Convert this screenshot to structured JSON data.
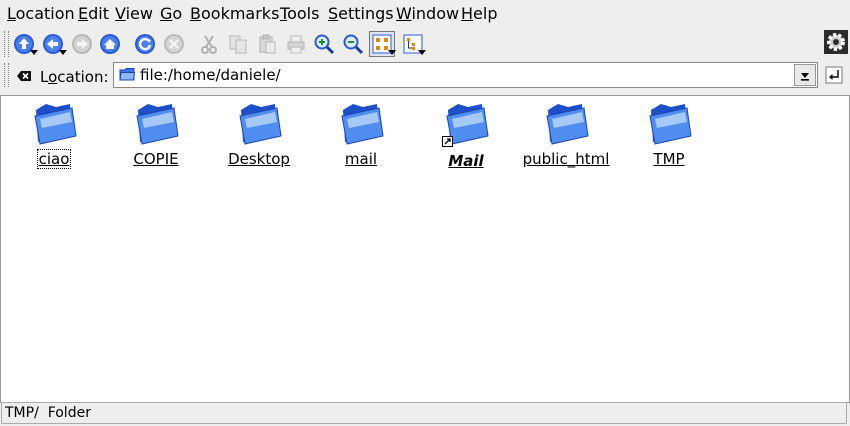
{
  "menu": {
    "items": [
      {
        "accel": "L",
        "rest": "ocation"
      },
      {
        "accel": "E",
        "rest": "dit"
      },
      {
        "accel": "V",
        "rest": "iew"
      },
      {
        "accel": "G",
        "rest": "o"
      },
      {
        "accel": "B",
        "rest": "ookmarks"
      },
      {
        "accel": "T",
        "rest": "ools"
      },
      {
        "accel": "S",
        "rest": "ettings"
      },
      {
        "accel": "W",
        "rest": "indow"
      },
      {
        "accel": "H",
        "rest": "elp"
      }
    ]
  },
  "location": {
    "label": "Location:",
    "label_accel_index": 1,
    "label_pre": "L",
    "label_accel": "o",
    "label_post": "cation:",
    "value": "file:/home/daniele/"
  },
  "files": [
    {
      "name": "ciao",
      "focused": true
    },
    {
      "name": "COPIE"
    },
    {
      "name": "Desktop"
    },
    {
      "name": "mail"
    },
    {
      "name": "Mail",
      "symlink": true
    },
    {
      "name": "public_html"
    },
    {
      "name": "TMP"
    }
  ],
  "status": {
    "text": "TMP/  Folder"
  },
  "colors": {
    "folder_blue": "#2f64e0",
    "folder_light": "#9cc6f5",
    "accent_blue": "#2a5bd7"
  }
}
